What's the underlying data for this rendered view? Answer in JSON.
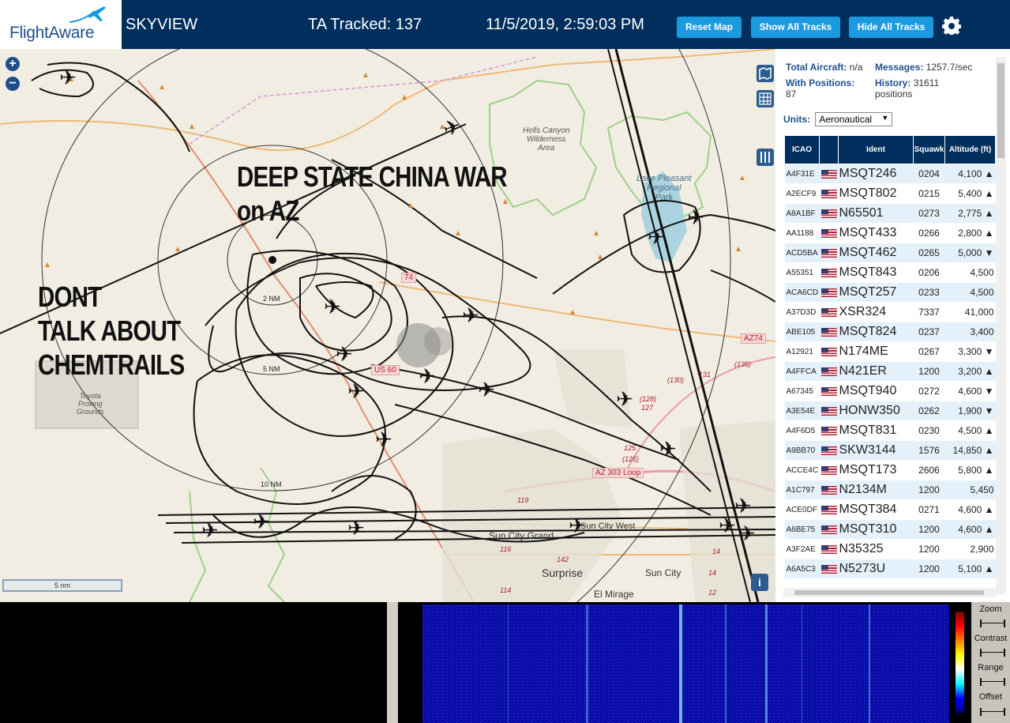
{
  "header": {
    "logo_text": "FlightAware",
    "app_title": "SKYVIEW",
    "tracked": "TA Tracked: 137",
    "clock": "11/5/2019, 2:59:03 PM",
    "buttons": {
      "reset": "Reset Map",
      "show_all": "Show All Tracks",
      "hide_all": "Hide All Tracks"
    },
    "settings_icon": "gear-icon"
  },
  "map": {
    "overlay_text_1": "DEEP STATE CHINA WAR\non AZ",
    "overlay_text_2": "DONT\nTALK ABOUT\nCHEMTRAILS",
    "labels": {
      "hells_canyon": "Hells Canyon\nWilderness\nArea",
      "lake_pleasant": "Lake Pleasant\nRegional\nPark",
      "toyota": "Toyota\nProving\nGrounds"
    },
    "towns": {
      "sun_city_grand": "Sun City Grand",
      "sun_city_west": "Sun City West",
      "surprise": "Surprise",
      "sun_city": "Sun City",
      "el_mirage": "El Mirage"
    },
    "roads": {
      "us60": "US 60",
      "az74_a": "74",
      "az74_b": "AZ74",
      "az303": "AZ 303 Loop"
    },
    "ring_labels": {
      "r2": "2 NM",
      "r5": "5 NM",
      "r10": "10 NM"
    },
    "route_numbers": [
      "(135)",
      "131",
      "(130)",
      "(128)",
      "127",
      "125",
      "(125)",
      "119",
      "116",
      "114",
      "142",
      "14",
      "14",
      "12"
    ],
    "scale_label": "5 nm",
    "zoom_in": "+",
    "zoom_out": "−",
    "info": "i"
  },
  "sidebar": {
    "total_aircraft_label": "Total Aircraft:",
    "total_aircraft_value": "n/a",
    "messages_label": "Messages:",
    "messages_value": "1257.7/sec",
    "with_positions_label": "With Positions:",
    "with_positions_value": "87",
    "history_label": "History:",
    "history_value": "31611 positions",
    "units_label": "Units:",
    "units_value": "Aeronautical",
    "table_headers": {
      "icao": "ICAO",
      "flag": "",
      "ident": "Ident",
      "squawk": "Squawk",
      "altitude": "Altitude (ft)"
    },
    "rows": [
      {
        "icao": "A4F31E",
        "ident": "MSQT246",
        "squawk": "0204",
        "alt": "4,100 ▲"
      },
      {
        "icao": "A2ECF9",
        "ident": "MSQT802",
        "squawk": "0215",
        "alt": "5,400 ▲"
      },
      {
        "icao": "A8A1BF",
        "ident": "N65501",
        "squawk": "0273",
        "alt": "2,775 ▲"
      },
      {
        "icao": "AA1188",
        "ident": "MSQT433",
        "squawk": "0266",
        "alt": "2,800 ▲"
      },
      {
        "icao": "ACD5BA",
        "ident": "MSQT462",
        "squawk": "0265",
        "alt": "5,000 ▼"
      },
      {
        "icao": "A55351",
        "ident": "MSQT843",
        "squawk": "0206",
        "alt": "4,500"
      },
      {
        "icao": "ACA6CD",
        "ident": "MSQT257",
        "squawk": "0233",
        "alt": "4,500"
      },
      {
        "icao": "A37D3D",
        "ident": "XSR324",
        "squawk": "7337",
        "alt": "41,000"
      },
      {
        "icao": "ABE105",
        "ident": "MSQT824",
        "squawk": "0237",
        "alt": "3,400"
      },
      {
        "icao": "A12921",
        "ident": "N174ME",
        "squawk": "0267",
        "alt": "3,300 ▼"
      },
      {
        "icao": "A4FFCA",
        "ident": "N421ER",
        "squawk": "1200",
        "alt": "3,200 ▲"
      },
      {
        "icao": "A67345",
        "ident": "MSQT940",
        "squawk": "0272",
        "alt": "4,600 ▼"
      },
      {
        "icao": "A3E54E",
        "ident": "HONW350",
        "squawk": "0262",
        "alt": "1,900 ▼"
      },
      {
        "icao": "A4F6D5",
        "ident": "MSQT831",
        "squawk": "0230",
        "alt": "4,500 ▲"
      },
      {
        "icao": "A9BB70",
        "ident": "SKW3144",
        "squawk": "1576",
        "alt": "14,850 ▲"
      },
      {
        "icao": "ACCE4C",
        "ident": "MSQT173",
        "squawk": "2606",
        "alt": "5,800 ▲"
      },
      {
        "icao": "A1C797",
        "ident": "N2134M",
        "squawk": "1200",
        "alt": "5,450"
      },
      {
        "icao": "ACE0DF",
        "ident": "MSQT384",
        "squawk": "0271",
        "alt": "4,600 ▲"
      },
      {
        "icao": "A6BE75",
        "ident": "MSQT310",
        "squawk": "1200",
        "alt": "4,600 ▲"
      },
      {
        "icao": "A3F2AE",
        "ident": "N35325",
        "squawk": "1200",
        "alt": "2,900"
      },
      {
        "icao": "A6A5C3",
        "ident": "N5273U",
        "squawk": "1200",
        "alt": "5,100 ▲"
      }
    ]
  },
  "spectrum": {
    "controls": [
      "Zoom",
      "Contrast",
      "Range",
      "Offset"
    ]
  },
  "colors": {
    "header_bg": "#002f5d",
    "button_bg": "#1b9ae0",
    "row_alt": "#e4f1fb",
    "waterfall": "#0a0aa0"
  }
}
